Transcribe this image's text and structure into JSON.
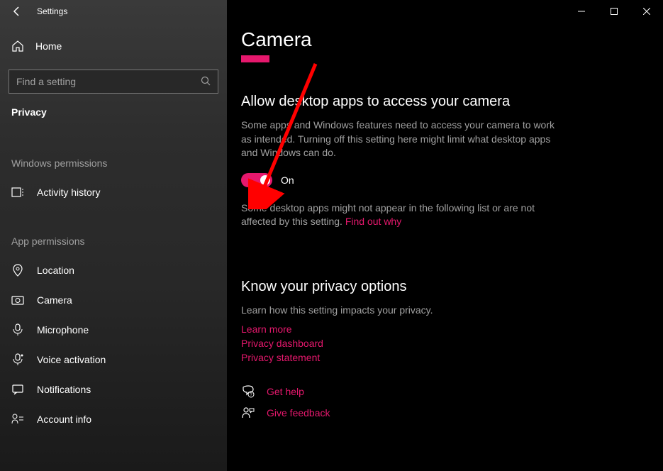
{
  "window": {
    "title": "Settings"
  },
  "sidebar": {
    "home": "Home",
    "search_placeholder": "Find a setting",
    "current_section": "Privacy",
    "group_windows": "Windows permissions",
    "group_app": "App permissions",
    "windows_items": [
      {
        "label": "Activity history"
      }
    ],
    "app_items": [
      {
        "label": "Location"
      },
      {
        "label": "Camera"
      },
      {
        "label": "Microphone"
      },
      {
        "label": "Voice activation"
      },
      {
        "label": "Notifications"
      },
      {
        "label": "Account info"
      }
    ]
  },
  "main": {
    "title": "Camera",
    "section_heading": "Allow desktop apps to access your camera",
    "section_desc": "Some apps and Windows features need to access your camera to work as intended. Turning off this setting here might limit what desktop apps and Windows can do.",
    "toggle_state": "On",
    "note_prefix": "Some desktop apps might not appear in the following list or are not affected by this setting. ",
    "note_link": "Find out why",
    "know_heading": "Know your privacy options",
    "know_desc": "Learn how this setting impacts your privacy.",
    "links": {
      "learn_more": "Learn more",
      "dashboard": "Privacy dashboard",
      "statement": "Privacy statement"
    },
    "help": "Get help",
    "feedback": "Give feedback"
  }
}
